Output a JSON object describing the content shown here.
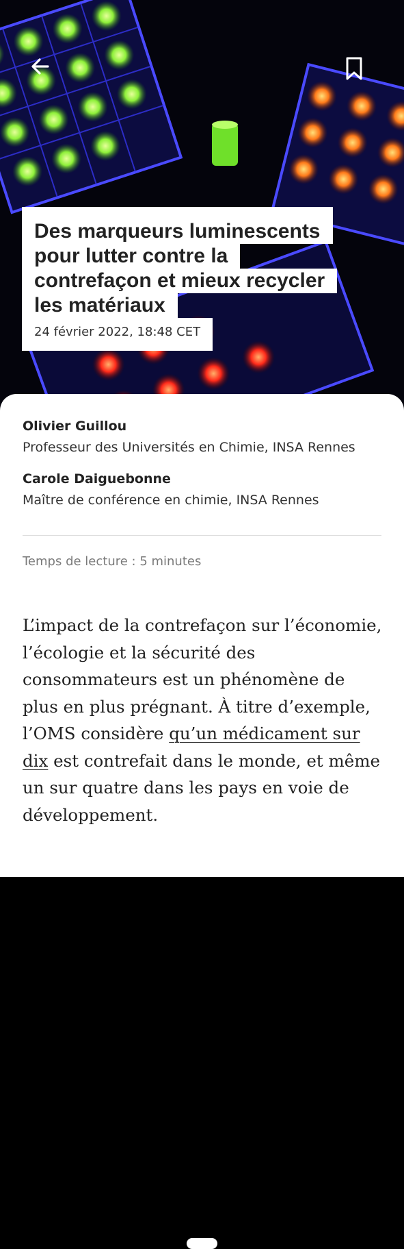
{
  "header": {
    "back_icon": "arrow-left-icon",
    "bookmark_icon": "bookmark-icon"
  },
  "article": {
    "title_lines": [
      "Des marqueurs luminescents",
      "pour lutter contre la",
      "contrefaçon et mieux recycler",
      "les matériaux"
    ],
    "date": "24 février 2022, 18:48 CET",
    "hero_image": "luminescent-markers-photo"
  },
  "authors": [
    {
      "name": "Olivier Guillou",
      "role": "Professeur des Universités en Chimie, INSA Rennes"
    },
    {
      "name": "Carole Daiguebonne",
      "role": "Maître de conférence en chimie, INSA Rennes"
    }
  ],
  "reading_time": "Temps de lecture : 5 minutes",
  "body": {
    "text_before_link": "L’impact de la contrefaçon sur l’économie, l’écologie et la sécurité des consommateurs est un phénomène de plus en plus prégnant. À titre d’exemple, l’OMS considère ",
    "link_text": "qu’un médicament sur dix",
    "text_after_link": " est contrefait dans le monde, et même un sur quatre dans les pays en voie de développement."
  },
  "colors": {
    "accent_green": "#7ef03a",
    "accent_orange": "#ff7a1a",
    "accent_red": "#ff2a1a",
    "glow_blue": "#3a3aff"
  }
}
